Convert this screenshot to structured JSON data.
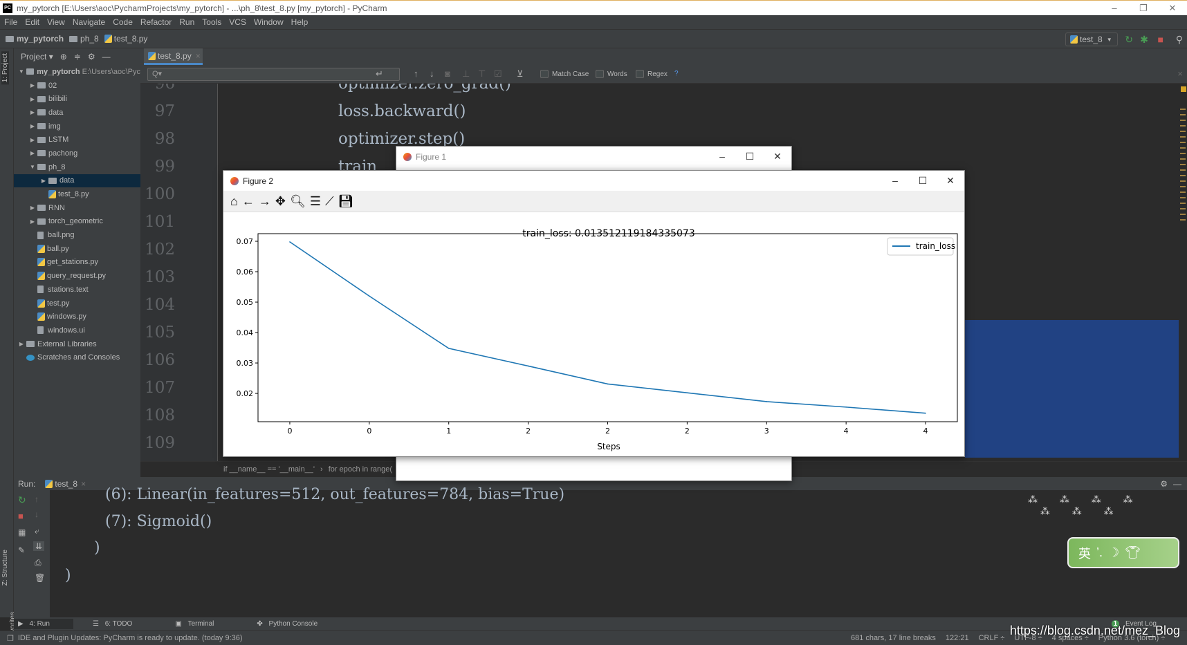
{
  "window": {
    "title": "my_pytorch [E:\\Users\\aoc\\PycharmProjects\\my_pytorch] - ...\\ph_8\\test_8.py [my_pytorch] - PyCharm",
    "min": "–",
    "max": "❐",
    "close": "✕"
  },
  "menu": [
    "File",
    "Edit",
    "View",
    "Navigate",
    "Code",
    "Refactor",
    "Run",
    "Tools",
    "VCS",
    "Window",
    "Help"
  ],
  "breadcrumb": [
    "my_pytorch",
    "ph_8",
    "test_8.py"
  ],
  "run_config": "test_8",
  "side_tabs": {
    "project": "1: Project",
    "structure": "Z: Structure",
    "favorites": "2: Favorites"
  },
  "project": {
    "header": "Project",
    "root": "my_pytorch",
    "root_path": "E:\\Users\\aoc\\Pyc",
    "items": [
      {
        "label": "02",
        "type": "folder",
        "depth": 1,
        "arrow": "▶"
      },
      {
        "label": "bilibili",
        "type": "folder",
        "depth": 1,
        "arrow": "▶"
      },
      {
        "label": "data",
        "type": "folder",
        "depth": 1,
        "arrow": "▶"
      },
      {
        "label": "img",
        "type": "folder",
        "depth": 1,
        "arrow": "▶"
      },
      {
        "label": "LSTM",
        "type": "folder",
        "depth": 1,
        "arrow": "▶"
      },
      {
        "label": "pachong",
        "type": "folder",
        "depth": 1,
        "arrow": "▶"
      },
      {
        "label": "ph_8",
        "type": "folder",
        "depth": 1,
        "arrow": "▼"
      },
      {
        "label": "data",
        "type": "folder",
        "depth": 2,
        "arrow": "▶",
        "selected": true
      },
      {
        "label": "test_8.py",
        "type": "py",
        "depth": 2,
        "arrow": ""
      },
      {
        "label": "RNN",
        "type": "folder",
        "depth": 1,
        "arrow": "▶"
      },
      {
        "label": "torch_geometric",
        "type": "folder",
        "depth": 1,
        "arrow": "▶"
      },
      {
        "label": "ball.png",
        "type": "file",
        "depth": 1,
        "arrow": ""
      },
      {
        "label": "ball.py",
        "type": "py",
        "depth": 1,
        "arrow": ""
      },
      {
        "label": "get_stations.py",
        "type": "py",
        "depth": 1,
        "arrow": ""
      },
      {
        "label": "query_request.py",
        "type": "py",
        "depth": 1,
        "arrow": ""
      },
      {
        "label": "stations.text",
        "type": "file",
        "depth": 1,
        "arrow": ""
      },
      {
        "label": "test.py",
        "type": "py",
        "depth": 1,
        "arrow": ""
      },
      {
        "label": "windows.py",
        "type": "py",
        "depth": 1,
        "arrow": ""
      },
      {
        "label": "windows.ui",
        "type": "file",
        "depth": 1,
        "arrow": ""
      },
      {
        "label": "External Libraries",
        "type": "lib",
        "depth": 0,
        "arrow": "▶"
      },
      {
        "label": "Scratches and Consoles",
        "type": "scratch",
        "depth": 0,
        "arrow": ""
      }
    ]
  },
  "editor": {
    "tab": "test_8.py",
    "search": {
      "placeholder": "Q▾",
      "match_case": "Match Case",
      "words": "Words",
      "regex": "Regex",
      "help": "?"
    },
    "line_numbers": [
      "96",
      "97",
      "98",
      "99",
      "100",
      "101",
      "102",
      "103",
      "104",
      "105",
      "106",
      "107",
      "108",
      "109"
    ],
    "lines": [
      "optimizer.zero_grad()",
      "loss.backward()",
      "optimizer.step()",
      "train_"
    ],
    "code_breadcrumb": [
      "if __name__ == '__main__'",
      "for epoch in range("
    ]
  },
  "run": {
    "label": "Run:",
    "tab": "test_8",
    "console": [
      "(6): Linear(in_features=512, out_features=784, bias=True)",
      "(7): Sigmoid()",
      "  )",
      ")"
    ]
  },
  "bottom_tabs": [
    "4: Run",
    "6: TODO",
    "Terminal",
    "Python Console"
  ],
  "event_log": "Event Log",
  "event_count": "1",
  "status": {
    "message": "IDE and Plugin Updates: PyCharm is ready to update. (today 9:36)",
    "chars": "681 chars, 17 line breaks",
    "position": "122:21",
    "line_sep": "CRLF ÷",
    "encoding": "UTF-8 ÷",
    "indent": "4 spaces ÷",
    "interpreter": "Python 3.6 (torch) ÷"
  },
  "figure1": {
    "title": "Figure 1"
  },
  "figure2": {
    "title": "Figure 2",
    "toolbar": [
      "home-icon",
      "back-icon",
      "forward-icon",
      "pan-icon",
      "zoom-icon",
      "configure-icon",
      "edit-axes-icon",
      "save-icon"
    ]
  },
  "ime": {
    "label": "英"
  },
  "watermark": "https://blog.csdn.net/mez_Blog",
  "chart_data": {
    "type": "line",
    "title": "train_loss: 0.013512119184335073",
    "xlabel": "Steps",
    "ylabel": "",
    "x": [
      0,
      1,
      2,
      3,
      4,
      5,
      6,
      7,
      8
    ],
    "xtick_labels": [
      "0",
      "0",
      "1",
      "2",
      "2",
      "2",
      "3",
      "4",
      "4"
    ],
    "series": [
      {
        "name": "train_loss",
        "color": "#1f77b4",
        "values": [
          0.0698,
          0.052,
          0.0348,
          0.029,
          0.0231,
          0.0202,
          0.0173,
          0.0155,
          0.0135
        ]
      }
    ],
    "yticks": [
      "0.02",
      "0.03",
      "0.04",
      "0.05",
      "0.06",
      "0.07"
    ],
    "xlim": [
      -0.4,
      8.4
    ],
    "ylim": [
      0.0107,
      0.0725
    ],
    "grid": false,
    "legend": "top-right"
  }
}
